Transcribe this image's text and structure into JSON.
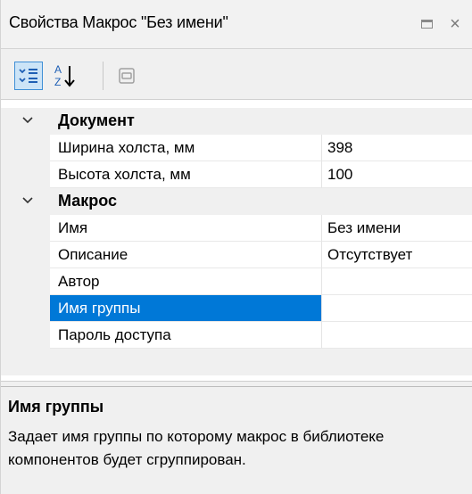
{
  "window": {
    "title": "Свойства Макрос \"Без имени\"",
    "restore_icon": "restore-icon",
    "close_glyph": "×"
  },
  "toolbar": {
    "buttons": [
      {
        "icon": "categorized-icon",
        "pressed": true
      },
      {
        "icon": "sort-alphabetical-icon",
        "pressed": false
      },
      {
        "icon": "property-pages-icon",
        "pressed": false
      }
    ],
    "alpha_top": "A",
    "alpha_bottom": "Z"
  },
  "grid": {
    "categories": [
      {
        "label": "Документ",
        "expanded": true,
        "properties": [
          {
            "name": "Ширина холста, мм",
            "value": "398"
          },
          {
            "name": "Высота холста, мм",
            "value": "100"
          }
        ]
      },
      {
        "label": "Макрос",
        "expanded": true,
        "properties": [
          {
            "name": "Имя",
            "value": "Без имени"
          },
          {
            "name": "Описание",
            "value": "Отсутствует"
          },
          {
            "name": "Автор",
            "value": ""
          },
          {
            "name": "Имя группы",
            "value": "",
            "selected": true
          },
          {
            "name": "Пароль доступа",
            "value": ""
          }
        ]
      }
    ]
  },
  "help": {
    "title": "Имя группы",
    "description": "Задает имя группы по которому макрос в библиотеке компонентов будет сгруппирован."
  },
  "colors": {
    "selection": "#0078d7",
    "pressed_button_bg": "#cce4f7",
    "pressed_button_border": "#3f8fd6",
    "panel_bg": "#f0f0f0"
  }
}
